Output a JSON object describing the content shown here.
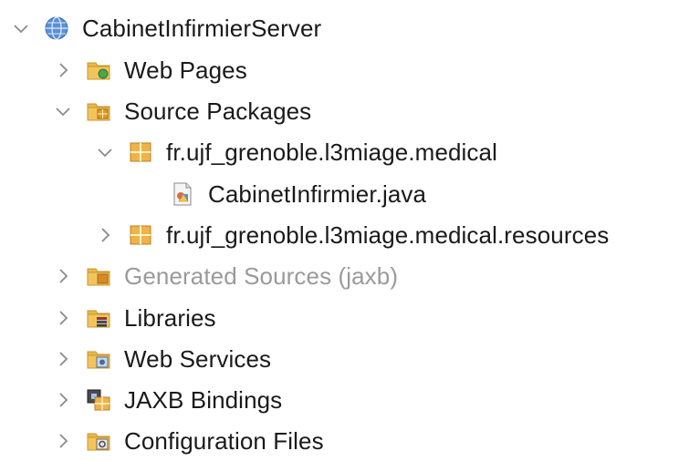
{
  "tree": {
    "root": {
      "label": "CabinetInfirmierServer",
      "expanded": true,
      "icon": "globe-icon"
    },
    "items": [
      {
        "label": "Web Pages",
        "expanded": false,
        "icon": "web-pages-folder-icon"
      },
      {
        "label": "Source Packages",
        "expanded": true,
        "icon": "source-packages-folder-icon"
      },
      {
        "label": "fr.ujf_grenoble.l3miage.medical",
        "expanded": true,
        "icon": "package-icon"
      },
      {
        "label": "CabinetInfirmier.java",
        "icon": "java-file-icon"
      },
      {
        "label": "fr.ujf_grenoble.l3miage.medical.resources",
        "expanded": false,
        "icon": "package-icon"
      },
      {
        "label": "Generated Sources (jaxb)",
        "expanded": false,
        "icon": "generated-sources-folder-icon",
        "muted": true
      },
      {
        "label": "Libraries",
        "expanded": false,
        "icon": "libraries-folder-icon"
      },
      {
        "label": "Web Services",
        "expanded": false,
        "icon": "web-services-folder-icon"
      },
      {
        "label": "JAXB Bindings",
        "expanded": false,
        "icon": "jaxb-bindings-icon"
      },
      {
        "label": "Configuration Files",
        "expanded": false,
        "icon": "configuration-folder-icon"
      }
    ]
  },
  "colors": {
    "folder": "#e8b84a",
    "folder_dark": "#c9962b",
    "package": "#e0a23a",
    "globe": "#5b8fd6",
    "chevron": "#8a8a8a",
    "muted_text": "#9a9a9a"
  }
}
